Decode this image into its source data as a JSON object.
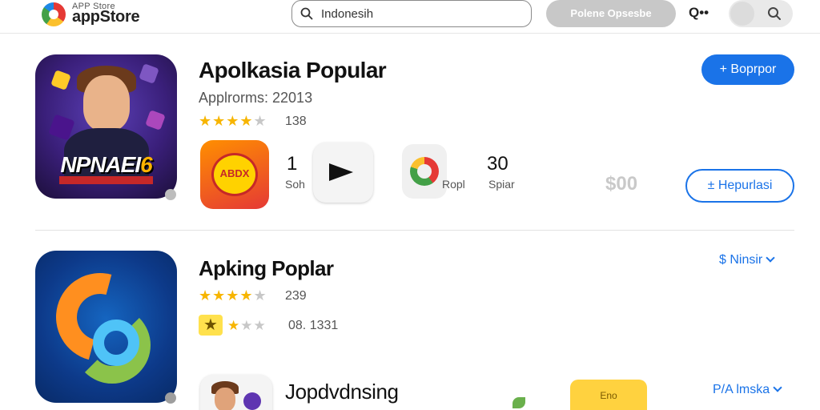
{
  "header": {
    "logo_small": "APP Store",
    "logo_main": "appStore",
    "search_value": "Indonesih",
    "pill_button": "Polene Opsesbe",
    "qdots": "Q••"
  },
  "section1": {
    "icon_word": "NPNAEI",
    "icon_num": "6",
    "title": "Apolkasia Popular",
    "subtitle": "Applrorms: 22013",
    "rating_count": "138",
    "mini_a_text": "ABDX",
    "stat1_num": "1",
    "stat1_label": "Soh",
    "stat2_label": "Ropl",
    "stat3_num": "30",
    "stat3_label": "Spiar",
    "ghost_price": "$00",
    "btn_primary": "+ Boprpor",
    "btn_secondary": "± Hepurlasi"
  },
  "section2": {
    "title": "Apking Poplar",
    "rating_count": "239",
    "rating2_count": "08. 1331",
    "link1": "$ Ninsir",
    "link2": "P/A lmska",
    "title3": "Jopdvdnsing",
    "tile_text": "Eno"
  },
  "colors": {
    "accent": "#1a73e8",
    "star": "#f7b500"
  }
}
